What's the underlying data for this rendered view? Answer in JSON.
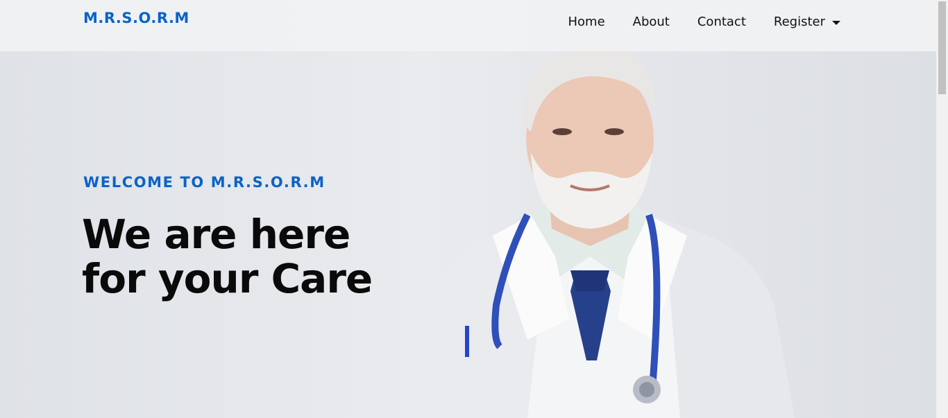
{
  "brand": {
    "name": "M.R.S.O.R.M"
  },
  "nav": {
    "items": [
      {
        "label": "Home"
      },
      {
        "label": "About"
      },
      {
        "label": "Contact"
      },
      {
        "label": "Register"
      }
    ]
  },
  "hero": {
    "subtitle": "WELCOME TO M.R.S.O.R.M",
    "headline_line1": "We are here",
    "headline_line2": "for your Care",
    "image_icon": "doctor-photo"
  },
  "colors": {
    "accent": "#0b63c6",
    "text": "#0a0a0a",
    "navbar_bg": "#f0f1f3"
  }
}
